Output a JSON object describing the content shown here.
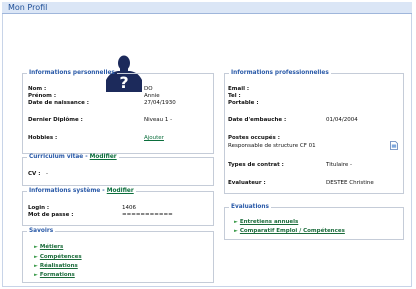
{
  "window": {
    "title": "Mon Profil"
  },
  "personal": {
    "legend": "Informations personnelles",
    "nom_label": "Nom :",
    "nom_value": "DO",
    "prenom_label": "Prénom :",
    "prenom_value": "Annie",
    "naissance_label": "Date de naissance :",
    "naissance_value": "27/04/1930",
    "diplome_label": "Dernier Diplôme :",
    "diplome_value": "Niveau 1 -",
    "hobbies_label": "Hobbies :",
    "hobbies_link": "Ajouter"
  },
  "cv": {
    "legend": "Curriculum vitae - ",
    "legend_link": "Modifier",
    "label": "CV :",
    "value": "-"
  },
  "system": {
    "legend": "Informations système - ",
    "legend_link": "Modifier",
    "login_label": "Login :",
    "login_value": "1406",
    "password_label": "Mot de passe :",
    "password_value": "==========="
  },
  "savoirs": {
    "legend": "Savoirs",
    "items": [
      "Métiers",
      "Compétences",
      "Réalisations",
      "Formations"
    ]
  },
  "professional": {
    "legend": "Informations professionnelles",
    "email_label": "Email :",
    "tel_label": "Tel :",
    "portable_label": "Portable :",
    "embauche_label": "Date d'embauche :",
    "embauche_value": "01/04/2004",
    "postes_label": "Postes occupés :",
    "postes_value": "Responsable de structure CF 01",
    "contrat_label": "Types de contrat :",
    "contrat_value": "Titulaire -",
    "evaluateur_label": "Evaluateur :",
    "evaluateur_value": "DESTEE Christine"
  },
  "evaluations": {
    "legend": "Evaluations",
    "items": [
      "Entretiens annuels",
      "Comparatif Emploi / Compétences"
    ]
  },
  "icons": {
    "avatar": "person-silhouette-icon",
    "document": "document-icon",
    "bullet": "arrow-bullet-icon"
  }
}
